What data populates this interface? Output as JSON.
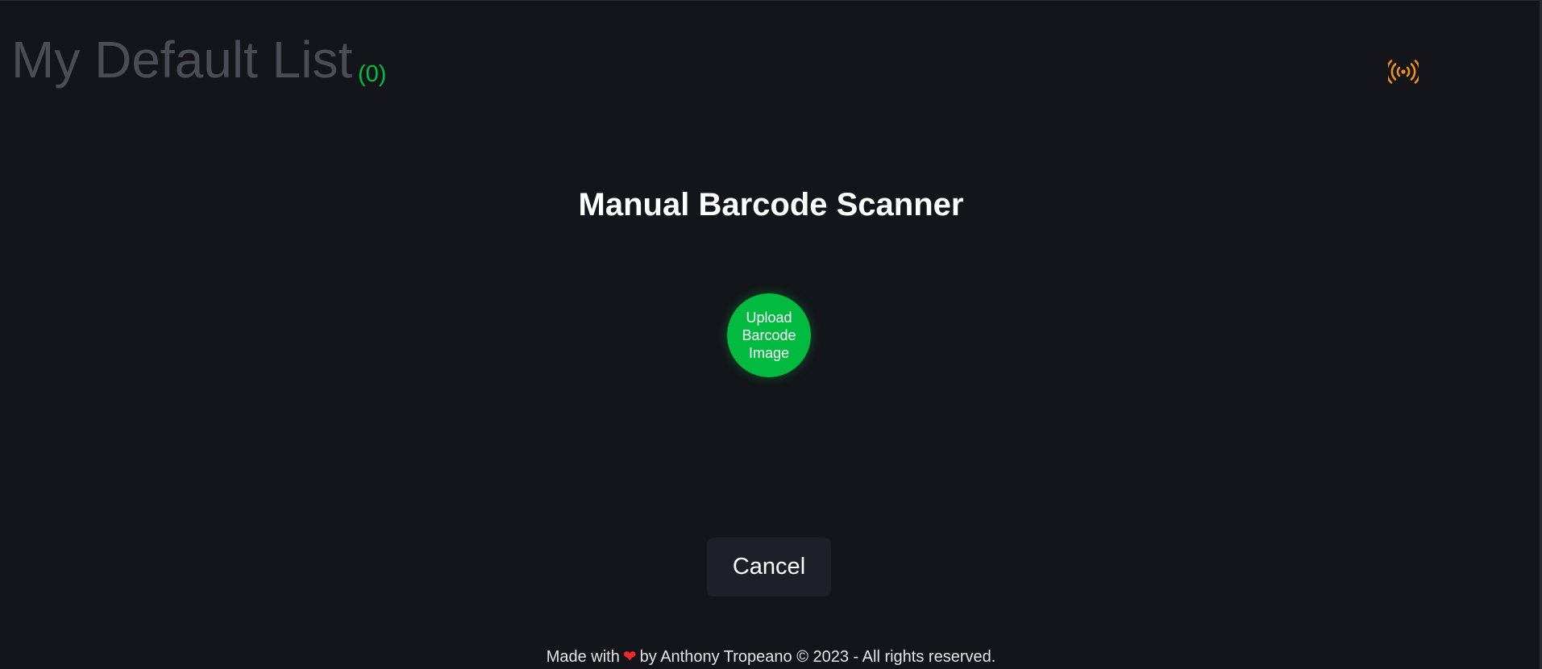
{
  "header": {
    "list_title": "My Default List",
    "item_count": "(0)",
    "status_icon": "broadcast-icon",
    "status_icon_color": "#f0901c"
  },
  "scanner": {
    "title": "Manual Barcode Scanner",
    "upload_label": "Upload\nBarcode\nImage",
    "upload_color": "#00bb3f",
    "cancel_label": "Cancel"
  },
  "footer": {
    "text_before": "Made with",
    "heart_icon": "heart-icon",
    "text_after": "by Anthony Tropeano © 2023 - All rights reserved."
  },
  "colors": {
    "background": "#13151a",
    "title_gray": "#4a4d55",
    "count_green": "#00c040",
    "cancel_bg": "#1d1f29"
  }
}
